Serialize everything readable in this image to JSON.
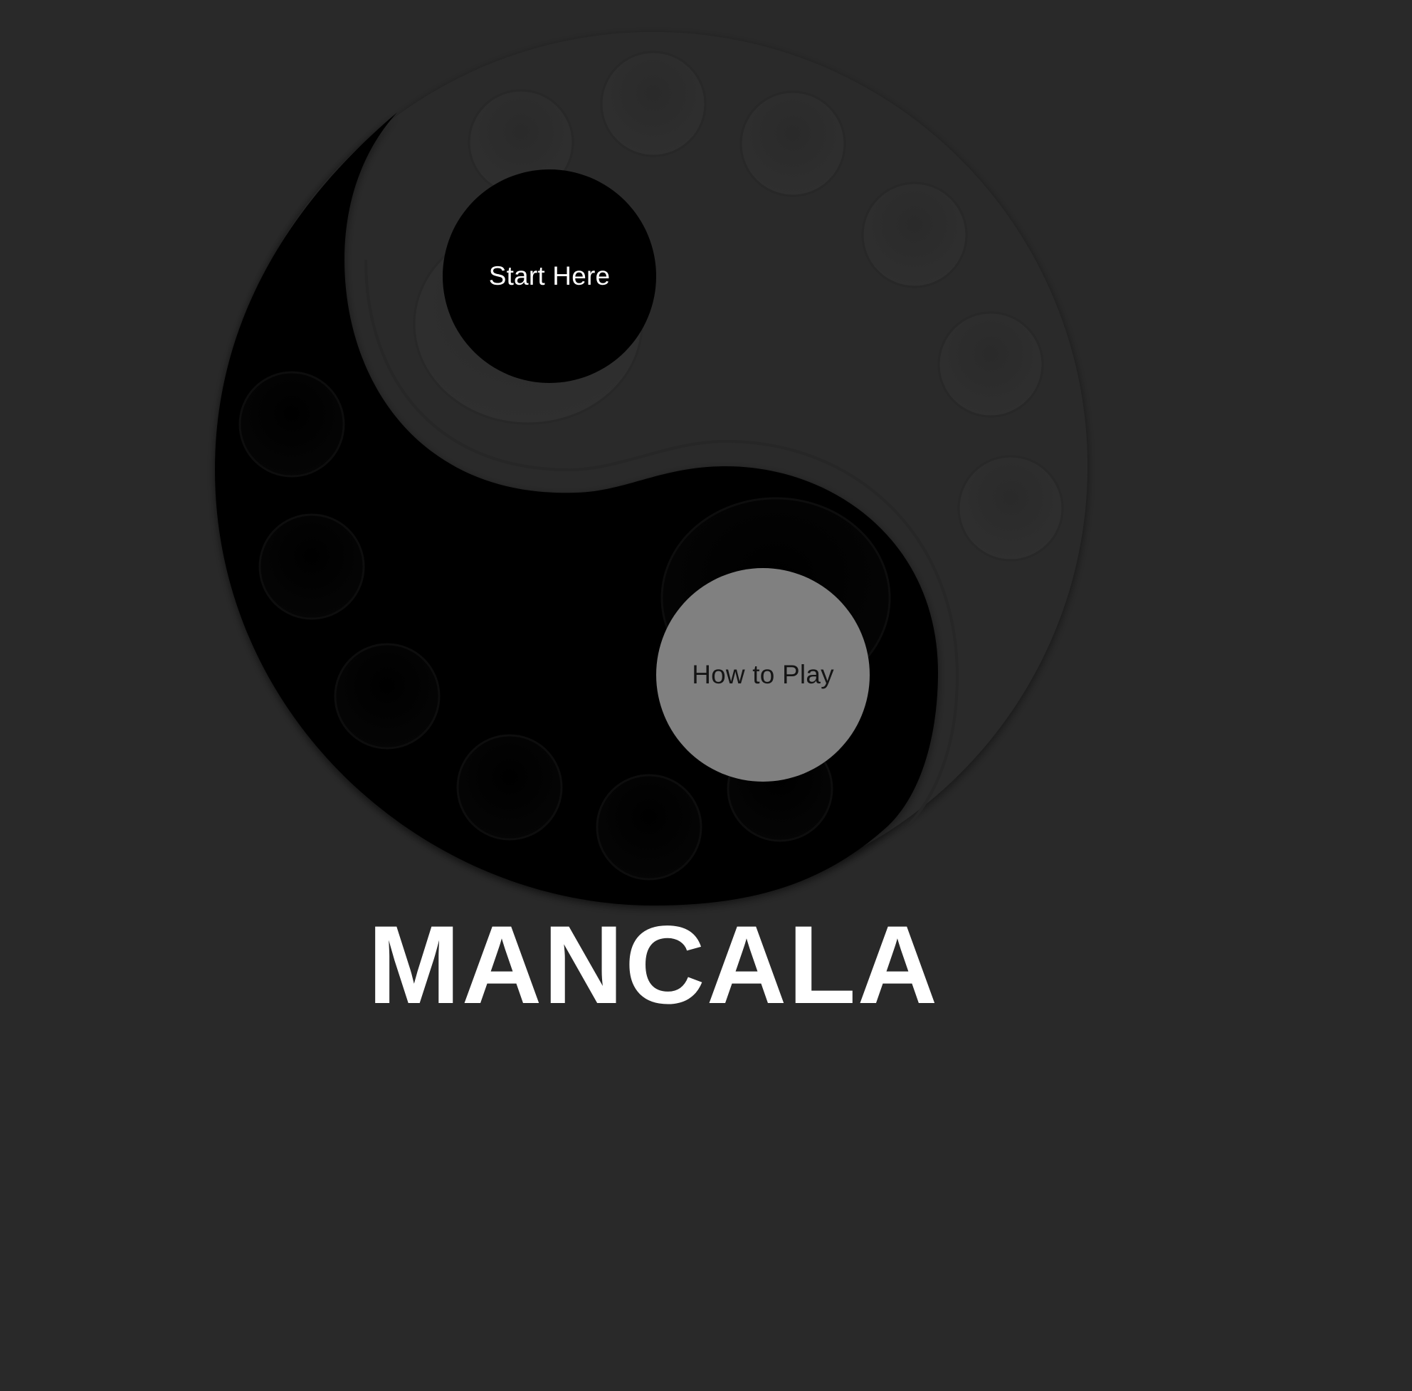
{
  "game": {
    "title": "MANCALA",
    "buttons": {
      "start_label": "Start Here",
      "how_label": "How to Play"
    }
  },
  "board": {
    "light_side_pits": 8,
    "dark_side_pits": 8
  },
  "colors": {
    "background": "#292929",
    "light_side": "#2c2c2c",
    "dark_side": "#000000",
    "pit_shadow": "#1f1f1f",
    "start_button_bg": "#000000",
    "start_button_text": "#ffffff",
    "how_button_bg": "#808080",
    "how_button_text": "#141414",
    "title_text": "#ffffff"
  }
}
